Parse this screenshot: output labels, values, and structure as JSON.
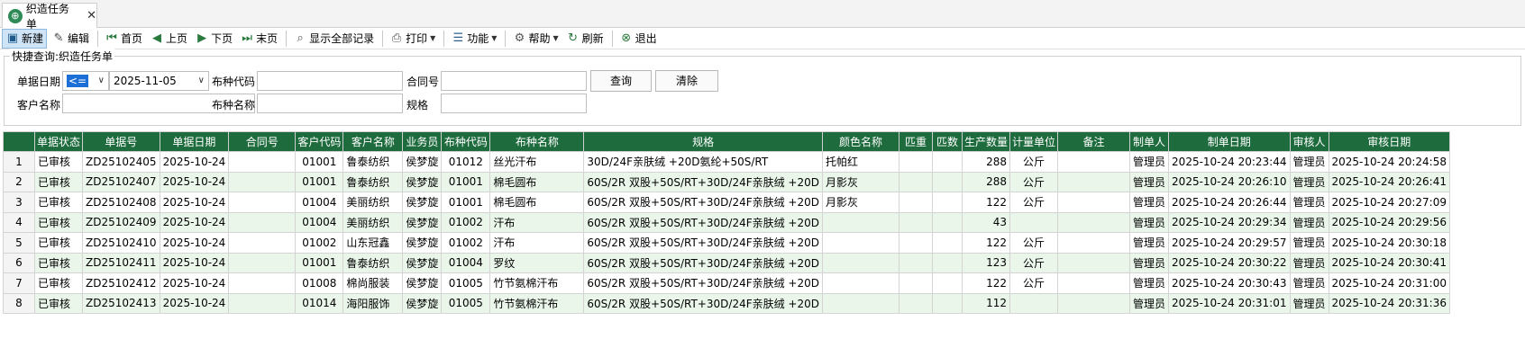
{
  "tab": {
    "icon": "globe-icon",
    "title": "织造任务单",
    "close": "✕"
  },
  "toolbar": {
    "new": "新建",
    "edit": "编辑",
    "first": "首页",
    "prev": "上页",
    "next": "下页",
    "last": "末页",
    "show_all": "显示全部记录",
    "print": "打印",
    "function": "功能",
    "help": "帮助",
    "refresh": "刷新",
    "exit": "退出"
  },
  "quick": {
    "legend": "快捷查询:织造任务单",
    "date_label": "单据日期",
    "date_op": "<=",
    "date_value": "2025-11-05",
    "cloth_code_label": "布种代码",
    "cloth_code_value": "",
    "contract_label": "合同号",
    "contract_value": "",
    "query_button": "查询",
    "clear_button": "清除",
    "customer_label": "客户名称",
    "customer_value": "",
    "cloth_name_label": "布种名称",
    "cloth_name_value": "",
    "spec_label": "规格",
    "spec_value": ""
  },
  "grid": {
    "columns": [
      "",
      "单据状态",
      "单据号",
      "单据日期",
      "合同号",
      "客户代码",
      "客户名称",
      "业务员",
      "布种代码",
      "布种名称",
      "规格",
      "颜色名称",
      "匹重",
      "匹数",
      "生产数量",
      "计量单位",
      "备注",
      "制单人",
      "制单日期",
      "审核人",
      "审核日期"
    ],
    "rows": [
      [
        "1",
        "已审核",
        "ZD25102405",
        "2025-10-24",
        "",
        "01001",
        "鲁泰纺织",
        "侯梦旋",
        "01012",
        "丝光汗布",
        "30D/24F亲肤绒 +20D氨纶+50S/RT",
        "托帕红",
        "",
        "",
        "288",
        "公斤",
        "",
        "管理员",
        "2025-10-24 20:23:44",
        "管理员",
        "2025-10-24 20:24:58"
      ],
      [
        "2",
        "已审核",
        "ZD25102407",
        "2025-10-24",
        "",
        "01001",
        "鲁泰纺织",
        "侯梦旋",
        "01001",
        "棉毛圆布",
        "60S/2R 双股+50S/RT+30D/24F亲肤绒 +20D",
        "月影灰",
        "",
        "",
        "288",
        "公斤",
        "",
        "管理员",
        "2025-10-24 20:26:10",
        "管理员",
        "2025-10-24 20:26:41"
      ],
      [
        "3",
        "已审核",
        "ZD25102408",
        "2025-10-24",
        "",
        "01004",
        "美丽纺织",
        "侯梦旋",
        "01001",
        "棉毛圆布",
        "60S/2R 双股+50S/RT+30D/24F亲肤绒 +20D",
        "月影灰",
        "",
        "",
        "122",
        "公斤",
        "",
        "管理员",
        "2025-10-24 20:26:44",
        "管理员",
        "2025-10-24 20:27:09"
      ],
      [
        "4",
        "已审核",
        "ZD25102409",
        "2025-10-24",
        "",
        "01004",
        "美丽纺织",
        "侯梦旋",
        "01002",
        "汗布",
        "60S/2R 双股+50S/RT+30D/24F亲肤绒 +20D",
        "",
        "",
        "",
        "43",
        "",
        "",
        "管理员",
        "2025-10-24 20:29:34",
        "管理员",
        "2025-10-24 20:29:56"
      ],
      [
        "5",
        "已审核",
        "ZD25102410",
        "2025-10-24",
        "",
        "01002",
        "山东冠鑫",
        "侯梦旋",
        "01002",
        "汗布",
        "60S/2R 双股+50S/RT+30D/24F亲肤绒 +20D",
        "",
        "",
        "",
        "122",
        "公斤",
        "",
        "管理员",
        "2025-10-24 20:29:57",
        "管理员",
        "2025-10-24 20:30:18"
      ],
      [
        "6",
        "已审核",
        "ZD25102411",
        "2025-10-24",
        "",
        "01001",
        "鲁泰纺织",
        "侯梦旋",
        "01004",
        "罗纹",
        "60S/2R 双股+50S/RT+30D/24F亲肤绒 +20D",
        "",
        "",
        "",
        "123",
        "公斤",
        "",
        "管理员",
        "2025-10-24 20:30:22",
        "管理员",
        "2025-10-24 20:30:41"
      ],
      [
        "7",
        "已审核",
        "ZD25102412",
        "2025-10-24",
        "",
        "01008",
        "棉尚服装",
        "侯梦旋",
        "01005",
        "竹节氨棉汗布",
        "60S/2R 双股+50S/RT+30D/24F亲肤绒 +20D",
        "",
        "",
        "",
        "122",
        "公斤",
        "",
        "管理员",
        "2025-10-24 20:30:43",
        "管理员",
        "2025-10-24 20:31:00"
      ],
      [
        "8",
        "已审核",
        "ZD25102413",
        "2025-10-24",
        "",
        "01014",
        "海阳服饰",
        "侯梦旋",
        "01005",
        "竹节氨棉汗布",
        "60S/2R 双股+50S/RT+30D/24F亲肤绒 +20D",
        "",
        "",
        "",
        "112",
        "",
        "",
        "管理员",
        "2025-10-24 20:31:01",
        "管理员",
        "2025-10-24 20:31:36"
      ]
    ]
  }
}
